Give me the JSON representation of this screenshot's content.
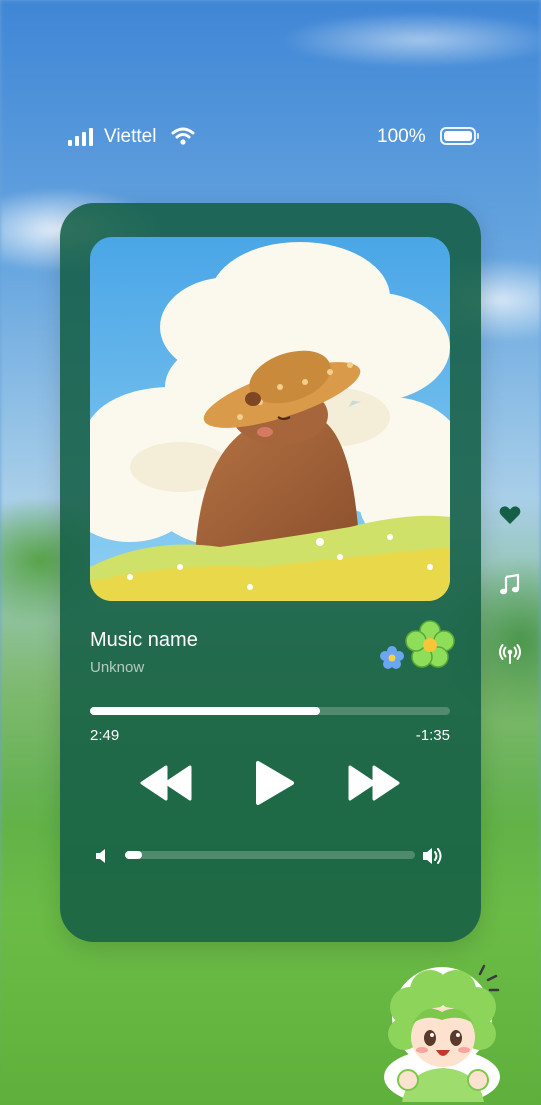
{
  "status_bar": {
    "carrier": "Viettel",
    "battery_percent": "100%",
    "signal_bars": 4
  },
  "player": {
    "song_title": "Music name",
    "artist": "Unknow",
    "time_elapsed": "2:49",
    "time_remaining": "-1:35",
    "progress": 0.64,
    "volume": 0.06,
    "card_color": "#145f46"
  },
  "icons": {
    "rewind": "rewind-icon",
    "play": "play-icon",
    "fast_forward": "fast-forward-icon",
    "volume_low": "volume-low-icon",
    "volume_high": "volume-high-icon",
    "heart": "heart-icon",
    "music": "music-note-icon",
    "broadcast": "broadcast-icon"
  }
}
